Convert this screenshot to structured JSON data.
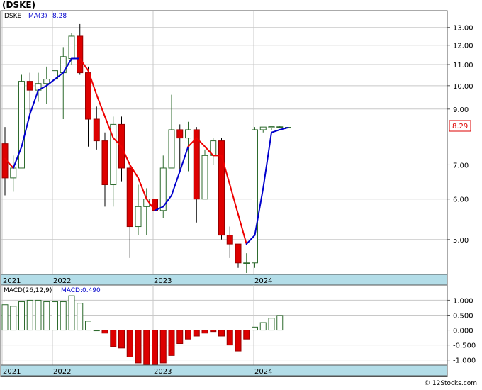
{
  "ticker_title": "(DSKE)",
  "legend": {
    "symbol": "DSKE",
    "ma_label": "MA(3)",
    "ma_value": "8.28"
  },
  "macd_legend": {
    "label": "MACD(26,12,9)",
    "value_text": "MACD:0.490"
  },
  "price_tag": "8.29",
  "watermark": "© 12Stocks.com",
  "colors": {
    "up": "#2e6b2e",
    "down": "#dd0000",
    "ma_up": "#0000cc",
    "ma_down": "#ee0000",
    "axis_band": "#b3dde8",
    "grid": "#c8c8c8"
  },
  "chart_data": [
    {
      "type": "candlestick",
      "title": "(DSKE)",
      "scale": "log",
      "ylim": [
        4.3,
        13.8
      ],
      "yticks": [
        "13.00",
        "12.00",
        "11.00",
        "10.00",
        "9.00",
        "7.00",
        "6.00",
        "5.00"
      ],
      "ytick_values": [
        13,
        12,
        11,
        10,
        9,
        7,
        6,
        5
      ],
      "xticks": [
        "2021",
        "2022",
        "2023",
        "2024"
      ],
      "last_price": 8.29,
      "candles": [
        {
          "o": 7.7,
          "h": 8.3,
          "l": 6.1,
          "c": 6.6
        },
        {
          "o": 6.6,
          "h": 7.3,
          "l": 6.2,
          "c": 6.9
        },
        {
          "o": 6.9,
          "h": 10.5,
          "l": 6.9,
          "c": 10.2
        },
        {
          "o": 10.2,
          "h": 10.6,
          "l": 8.6,
          "c": 9.8
        },
        {
          "o": 9.8,
          "h": 10.6,
          "l": 9.3,
          "c": 10.1
        },
        {
          "o": 10.1,
          "h": 10.9,
          "l": 9.2,
          "c": 10.3
        },
        {
          "o": 10.3,
          "h": 11.3,
          "l": 9.5,
          "c": 10.7
        },
        {
          "o": 10.6,
          "h": 11.9,
          "l": 8.6,
          "c": 11.4
        },
        {
          "o": 11.3,
          "h": 12.7,
          "l": 11.0,
          "c": 12.5
        },
        {
          "o": 12.5,
          "h": 13.2,
          "l": 10.5,
          "c": 10.6
        },
        {
          "o": 10.6,
          "h": 10.9,
          "l": 7.6,
          "c": 8.6
        },
        {
          "o": 8.6,
          "h": 9.1,
          "l": 7.5,
          "c": 7.8
        },
        {
          "o": 7.8,
          "h": 8.1,
          "l": 5.8,
          "c": 6.4
        },
        {
          "o": 6.4,
          "h": 8.7,
          "l": 5.8,
          "c": 8.4
        },
        {
          "o": 8.4,
          "h": 8.7,
          "l": 6.5,
          "c": 6.9
        },
        {
          "o": 6.9,
          "h": 7.0,
          "l": 4.6,
          "c": 5.3
        },
        {
          "o": 5.3,
          "h": 6.4,
          "l": 5.1,
          "c": 5.8
        },
        {
          "o": 5.8,
          "h": 6.3,
          "l": 5.1,
          "c": 6.0
        },
        {
          "o": 6.0,
          "h": 6.5,
          "l": 5.3,
          "c": 5.7
        },
        {
          "o": 5.7,
          "h": 7.3,
          "l": 5.5,
          "c": 6.9
        },
        {
          "o": 6.9,
          "h": 9.6,
          "l": 6.9,
          "c": 8.2
        },
        {
          "o": 8.2,
          "h": 8.4,
          "l": 6.8,
          "c": 7.9
        },
        {
          "o": 7.9,
          "h": 8.5,
          "l": 6.8,
          "c": 8.2
        },
        {
          "o": 8.2,
          "h": 8.3,
          "l": 5.4,
          "c": 6.0
        },
        {
          "o": 6.0,
          "h": 7.5,
          "l": 6.0,
          "c": 7.3
        },
        {
          "o": 7.3,
          "h": 7.9,
          "l": 7.0,
          "c": 7.8
        },
        {
          "o": 7.8,
          "h": 7.9,
          "l": 5.0,
          "c": 5.1
        },
        {
          "o": 5.1,
          "h": 5.3,
          "l": 4.6,
          "c": 4.9
        },
        {
          "o": 4.9,
          "h": 4.9,
          "l": 4.4,
          "c": 4.5
        },
        {
          "o": 4.5,
          "h": 4.7,
          "l": 4.3,
          "c": 4.5
        },
        {
          "o": 4.5,
          "h": 8.3,
          "l": 4.4,
          "c": 8.2
        },
        {
          "o": 8.2,
          "h": 8.3,
          "l": 8.1,
          "c": 8.3
        },
        {
          "o": 8.28,
          "h": 8.35,
          "l": 8.2,
          "c": 8.32
        },
        {
          "o": 8.29,
          "h": 8.35,
          "l": 8.25,
          "c": 8.31
        },
        {
          "o": 8.28,
          "h": 8.32,
          "l": 8.26,
          "c": 8.29
        }
      ],
      "ma3": [
        7.2,
        6.9,
        7.6,
        8.8,
        9.8,
        10.0,
        10.3,
        10.6,
        11.3,
        11.3,
        10.7,
        9.6,
        8.7,
        7.9,
        7.6,
        7.0,
        6.6,
        6.0,
        5.7,
        5.8,
        6.1,
        6.8,
        7.6,
        7.9,
        7.6,
        7.3,
        7.3,
        6.4,
        5.6,
        4.9,
        5.1,
        6.3,
        8.1,
        8.2,
        8.28
      ],
      "ma_color": [
        "down",
        "down",
        "up",
        "up",
        "up",
        "up",
        "up",
        "up",
        "up",
        "up",
        "down",
        "down",
        "down",
        "down",
        "down",
        "down",
        "down",
        "down",
        "down",
        "up",
        "up",
        "up",
        "up",
        "down",
        "down",
        "down",
        "down",
        "down",
        "down",
        "down",
        "up",
        "up",
        "up",
        "up",
        "up"
      ]
    },
    {
      "type": "bar",
      "title": "MACD(26,12,9)",
      "ylim": [
        -1.15,
        1.2
      ],
      "yticks": [
        "1.000",
        "0.500",
        "0.000",
        "-0.500",
        "-1.000"
      ],
      "ytick_values": [
        1.0,
        0.5,
        0.0,
        -0.5,
        -1.0
      ],
      "xticks": [
        "2021",
        "2022",
        "2023",
        "2024"
      ],
      "values": [
        0.85,
        0.8,
        0.95,
        1.0,
        1.0,
        0.95,
        0.95,
        0.95,
        1.15,
        0.9,
        0.3,
        0.0,
        -0.1,
        -0.55,
        -0.6,
        -0.9,
        -1.1,
        -1.15,
        -1.15,
        -1.1,
        -0.85,
        -0.45,
        -0.3,
        -0.2,
        -0.1,
        -0.05,
        -0.2,
        -0.5,
        -0.7,
        -0.3,
        0.1,
        0.25,
        0.4,
        0.49
      ]
    }
  ]
}
